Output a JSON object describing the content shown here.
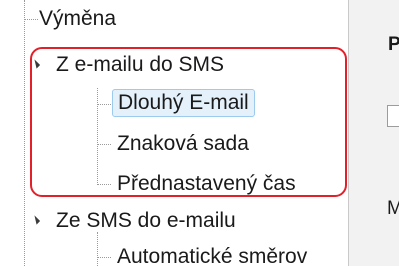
{
  "tree": {
    "items": [
      {
        "label": "Výměna"
      },
      {
        "label": "Z e-mailu do SMS",
        "expanded": true
      },
      {
        "label": "Dlouhý E-mail",
        "selected": true
      },
      {
        "label": "Znaková sada"
      },
      {
        "label": "Přednastavený čas"
      },
      {
        "label": "Ze SMS do e-mailu",
        "expanded": true
      },
      {
        "label": "Automatické směrov"
      }
    ],
    "highlight_color": "#e2202a"
  },
  "right_pane": {
    "label_top": "P",
    "label_bottom": "M"
  }
}
